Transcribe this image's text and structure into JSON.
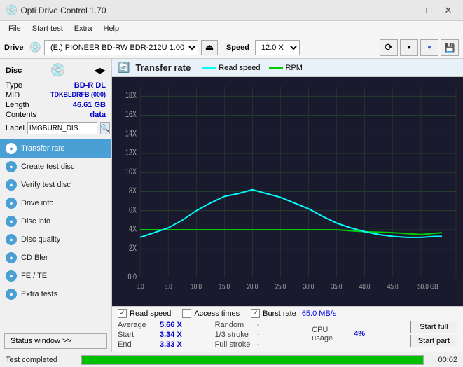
{
  "app": {
    "title": "Opti Drive Control 1.70",
    "icon": "💿"
  },
  "titlebar": {
    "minimize": "—",
    "maximize": "□",
    "close": "✕"
  },
  "menubar": {
    "items": [
      "File",
      "Start test",
      "Extra",
      "Help"
    ]
  },
  "drivebar": {
    "label": "Drive",
    "drive_value": "(E:)  PIONEER BD-RW   BDR-212U 1.00",
    "eject_icon": "⏏",
    "speed_label": "Speed",
    "speed_value": "12.0 X ↓",
    "icon_buttons": [
      "⟳",
      "🔴",
      "🔵",
      "💾"
    ]
  },
  "disc": {
    "title": "Disc",
    "arrows": "◀▶",
    "fields": [
      {
        "label": "Type",
        "value": "BD-R DL",
        "color": "blue"
      },
      {
        "label": "MID",
        "value": "TDKBLDRFB (000)",
        "color": "blue"
      },
      {
        "label": "Length",
        "value": "46.61 GB",
        "color": "blue"
      },
      {
        "label": "Contents",
        "value": "data",
        "color": "blue"
      }
    ],
    "label_field_label": "Label",
    "label_value": "IMGBURN_DIS",
    "label_icon": "🔍"
  },
  "nav": {
    "items": [
      {
        "id": "transfer-rate",
        "label": "Transfer rate",
        "active": true
      },
      {
        "id": "create-test-disc",
        "label": "Create test disc",
        "active": false
      },
      {
        "id": "verify-test-disc",
        "label": "Verify test disc",
        "active": false
      },
      {
        "id": "drive-info",
        "label": "Drive info",
        "active": false
      },
      {
        "id": "disc-info",
        "label": "Disc info",
        "active": false
      },
      {
        "id": "disc-quality",
        "label": "Disc quality",
        "active": false
      },
      {
        "id": "cd-bler",
        "label": "CD Bler",
        "active": false
      },
      {
        "id": "fe-te",
        "label": "FE / TE",
        "active": false
      },
      {
        "id": "extra-tests",
        "label": "Extra tests",
        "active": false
      }
    ]
  },
  "status_window_btn": "Status window >>",
  "chart": {
    "title": "Transfer rate",
    "legend": [
      {
        "label": "Read speed",
        "color": "#00ffff"
      },
      {
        "label": "RPM",
        "color": "#00cc00"
      }
    ],
    "y_labels": [
      "18X",
      "16X",
      "14X",
      "12X",
      "10X",
      "8X",
      "6X",
      "4X",
      "2X",
      "0.0"
    ],
    "x_labels": [
      "0.0",
      "5.0",
      "10.0",
      "15.0",
      "20.0",
      "25.0",
      "30.0",
      "35.0",
      "40.0",
      "45.0",
      "50.0 GB"
    ]
  },
  "checkboxes": [
    {
      "id": "read-speed",
      "label": "Read speed",
      "checked": true
    },
    {
      "id": "access-times",
      "label": "Access times",
      "checked": false
    },
    {
      "id": "burst-rate",
      "label": "Burst rate",
      "checked": true,
      "value": "65.0 MB/s"
    }
  ],
  "stats": {
    "left": [
      {
        "label": "Average",
        "value": "5.66 X"
      },
      {
        "label": "Start",
        "value": "3.34 X"
      },
      {
        "label": "End",
        "value": "3.33 X"
      }
    ],
    "middle": [
      {
        "label": "Random",
        "value": "-"
      },
      {
        "label": "1/3 stroke",
        "value": "-"
      },
      {
        "label": "Full stroke",
        "value": "-"
      }
    ],
    "right": [
      {
        "label": "CPU usage",
        "value": "4%"
      },
      {
        "label": "",
        "value": ""
      },
      {
        "label": "",
        "value": ""
      }
    ],
    "buttons": [
      "Start full",
      "Start part"
    ]
  },
  "statusbar": {
    "text": "Test completed",
    "progress": 100,
    "time": "00:02"
  }
}
